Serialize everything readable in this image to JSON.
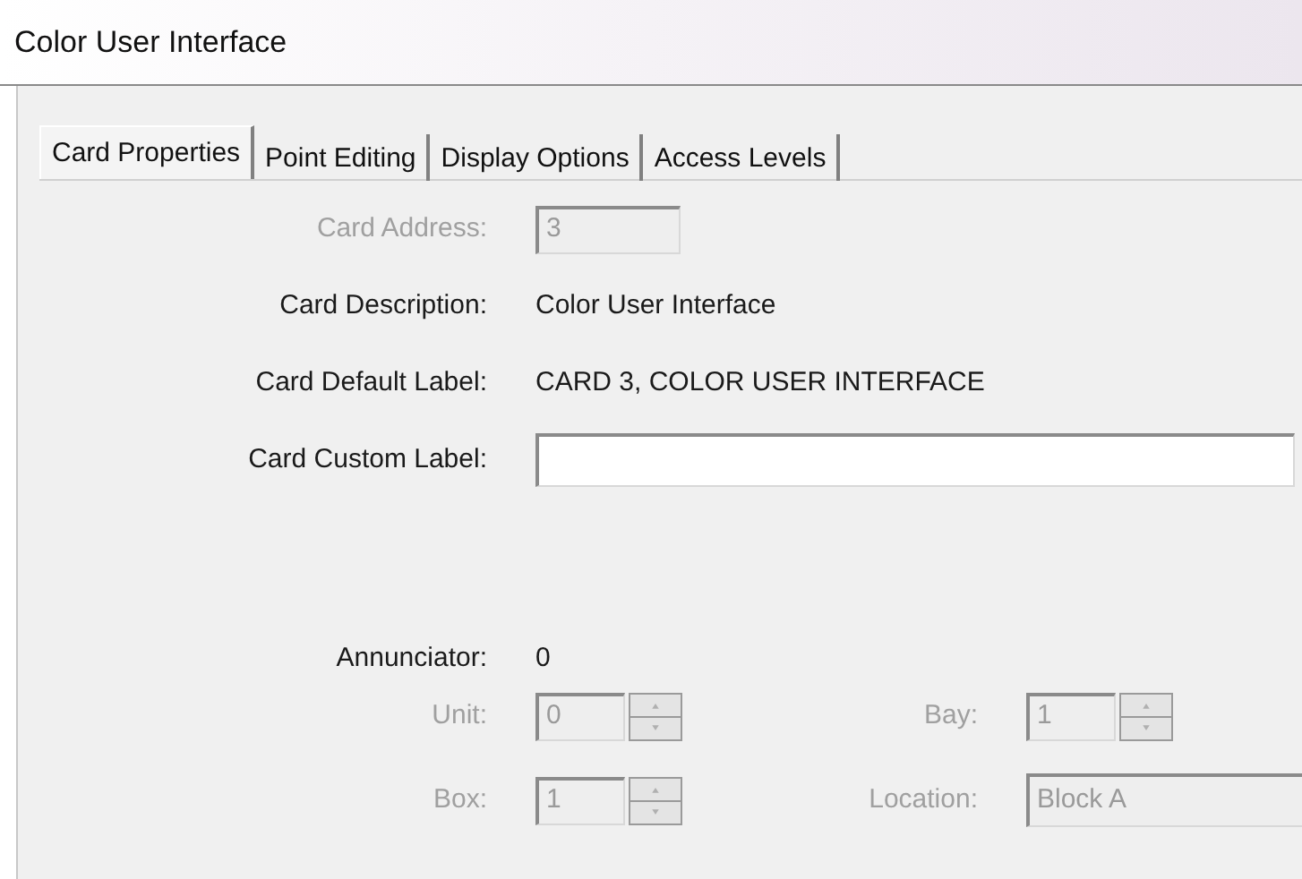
{
  "window": {
    "title": "Color User Interface"
  },
  "tabs": [
    {
      "label": "Card Properties",
      "selected": true
    },
    {
      "label": "Point Editing",
      "selected": false
    },
    {
      "label": "Display Options",
      "selected": false
    },
    {
      "label": "Access Levels",
      "selected": false
    }
  ],
  "card_address": {
    "label": "Card Address:",
    "value": "3",
    "disabled": true
  },
  "info_rows": [
    {
      "label": "Card Description:",
      "value": "Color User Interface"
    },
    {
      "label": "Card Default Label:",
      "value": "CARD 3, COLOR USER INTERFACE"
    }
  ],
  "card_custom_label": {
    "label": "Card Custom Label:"
  },
  "annunciator": {
    "label": "Annunciator:",
    "value": "0"
  },
  "location_rows": [
    [
      {
        "kind": "spinner",
        "label": "Unit:",
        "value": "0",
        "disabled": true
      },
      {
        "kind": "spinner",
        "label": "Bay:",
        "value": "1",
        "disabled": true
      }
    ],
    [
      {
        "kind": "spinner",
        "label": "Box:",
        "value": "1",
        "disabled": true
      },
      {
        "kind": "text",
        "label": "Location:",
        "value": "Block A",
        "disabled": true
      }
    ]
  ]
}
